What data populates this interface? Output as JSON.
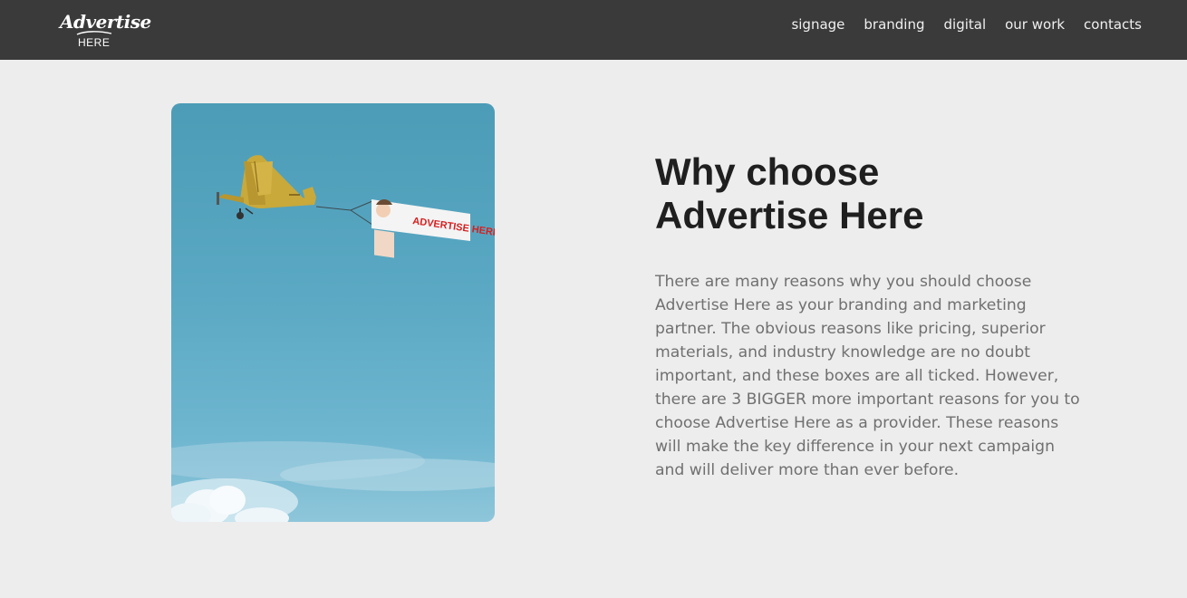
{
  "brand": {
    "logo_script": "Advertise",
    "logo_sub": "HERE"
  },
  "nav": {
    "items": [
      {
        "label": "signage"
      },
      {
        "label": "branding"
      },
      {
        "label": "digital"
      },
      {
        "label": "our work"
      },
      {
        "label": "contacts"
      }
    ]
  },
  "hero": {
    "banner_text": "ADVERTISE HERE",
    "heading": "Why choose Advertise Here",
    "body": "There are many reasons why you should choose Advertise Here as your branding and marketing partner. The obvious reasons like pricing, superior materials, and industry knowledge are no doubt important, and these boxes are all ticked. However, there are 3 BIGGER more important reasons for you to choose Advertise Here as a provider. These reasons will make the key difference in your next campaign and will deliver more than ever before."
  },
  "colors": {
    "navbar": "#3a3a3a",
    "page_bg": "#ededed",
    "heading": "#1f1f1f",
    "body_text": "#707070",
    "banner_text": "#d61f1f",
    "plane": "#c9a93a"
  }
}
